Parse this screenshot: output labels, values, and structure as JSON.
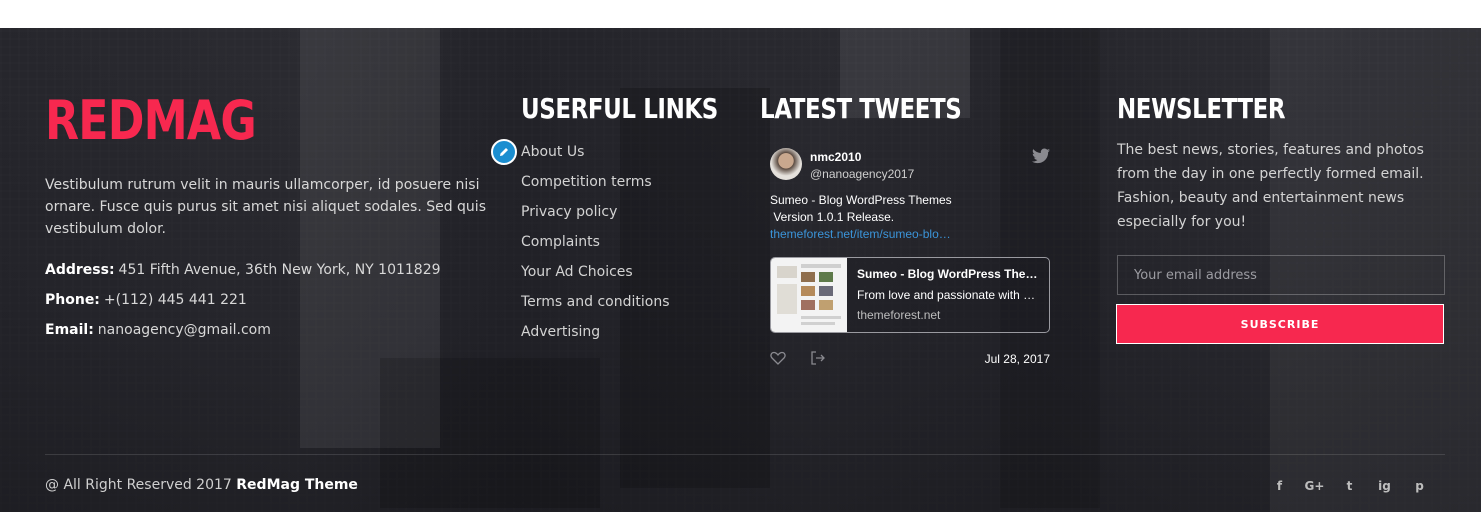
{
  "brand": {
    "logo": "REDMAG",
    "about": "Vestibulum rutrum velit in mauris ullamcorper, id posuere nisi ornare. Fusce quis purus sit amet nisi aliquet sodales. Sed quis vestibulum dolor.",
    "accent_color": "#f7284f"
  },
  "contact": {
    "address_label": "Address:",
    "address": "451 Fifth Avenue, 36th New York, NY 1011829",
    "phone_label": "Phone:",
    "phone": "+(112) 445 441 221",
    "email_label": "Email:",
    "email": "nanoagency@gmail.com"
  },
  "links": {
    "title": "USERFUL LINKS",
    "items": [
      "About Us",
      "Competition terms",
      "Privacy policy",
      "Complaints",
      "Your Ad Choices",
      "Terms and conditions",
      "Advertising"
    ]
  },
  "tweets": {
    "title": "LATEST TWEETS",
    "name": "nmc2010",
    "handle": "@nanoagency2017",
    "text_line1": "Sumeo - Blog WordPress Themes",
    "text_line2": " Version 1.0.1 Release.",
    "link": "themeforest.net/item/sumeo-blo…",
    "card_title": "Sumeo - Blog WordPress The…",
    "card_desc": "From love and passionate with …",
    "card_domain": "themeforest.net",
    "date": "Jul 28, 2017",
    "link_color": "#3b94d9"
  },
  "newsletter": {
    "title": "NEWSLETTER",
    "description": "The best news, stories, features and photos from the day in one perfectly formed email. Fashion, beauty and entertainment news especially for you!",
    "email_placeholder": "Your email address",
    "subscribe_label": "SUBSCRIBE"
  },
  "footer": {
    "copyright_prefix": "@ All Right Reserved 2017",
    "copyright_brand": "RedMag Theme",
    "social_icons": [
      "facebook-icon",
      "google-plus-icon",
      "twitter-icon",
      "instagram-icon",
      "pinterest-icon"
    ],
    "social_glyphs": [
      "f",
      "G+",
      "t",
      "ig",
      "p"
    ]
  }
}
